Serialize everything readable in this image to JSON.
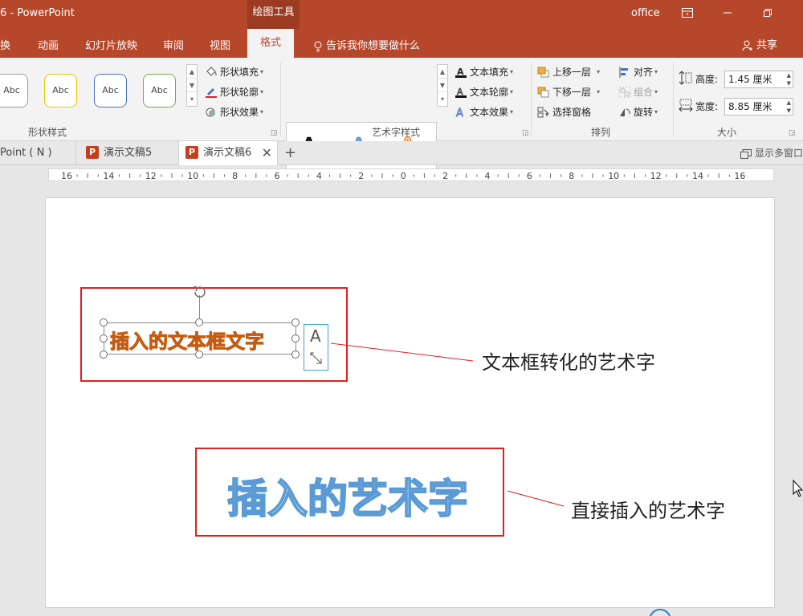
{
  "titlebar": {
    "title": "6  -  PowerPoint",
    "context_tab": "绘图工具",
    "user": "office",
    "restore_glyph": "⧉"
  },
  "menu": {
    "tabs": [
      "换",
      "动画",
      "幻灯片放映",
      "审阅",
      "视图",
      "格式"
    ],
    "tell_me": "告诉我你想要做什么",
    "share": "共享"
  },
  "ribbon": {
    "shape_styles": {
      "label": "形状样式",
      "swatches": [
        "Abc",
        "Abc",
        "Abc",
        "Abc"
      ],
      "fill": "形状填充",
      "outline": "形状轮廓",
      "effects": "形状效果"
    },
    "wordart": {
      "label": "艺术字样式",
      "letters": [
        "A",
        "A",
        "A"
      ],
      "text_fill": "文本填充",
      "text_outline": "文本轮廓",
      "text_effects": "文本效果"
    },
    "arrange": {
      "label": "排列",
      "bring_forward": "上移一层",
      "send_backward": "下移一层",
      "selection_pane": "选择窗格",
      "align": "对齐",
      "group": "组合",
      "rotate": "旋转"
    },
    "size": {
      "label": "大小",
      "height_label": "高度:",
      "height_value": "1.45 厘米",
      "width_label": "宽度:",
      "width_value": "8.85 厘米"
    }
  },
  "doc_tabs": {
    "tabs": [
      "Point ( N )",
      "演示文稿5",
      "演示文稿6"
    ],
    "active_index": 2,
    "new_tab": "+",
    "show_multi_window": "显示多窗口"
  },
  "ruler": {
    "labels": [
      "16",
      "14",
      "12",
      "10",
      "8",
      "6",
      "4",
      "2",
      "0",
      "2",
      "4",
      "6",
      "8",
      "10",
      "12",
      "14",
      "16"
    ]
  },
  "slide": {
    "textbox_text": "插入的文本框文字",
    "textbox_callout": "文本框转化的艺术字",
    "wordart_text": "插入的艺术字",
    "wordart_callout": "直接插入的艺术字",
    "layout_options_glyph": "A"
  },
  "colors": {
    "accent": "#b7472a",
    "orange": "#ed7d31",
    "blue": "#5b9bd5",
    "red": "#e02020"
  }
}
